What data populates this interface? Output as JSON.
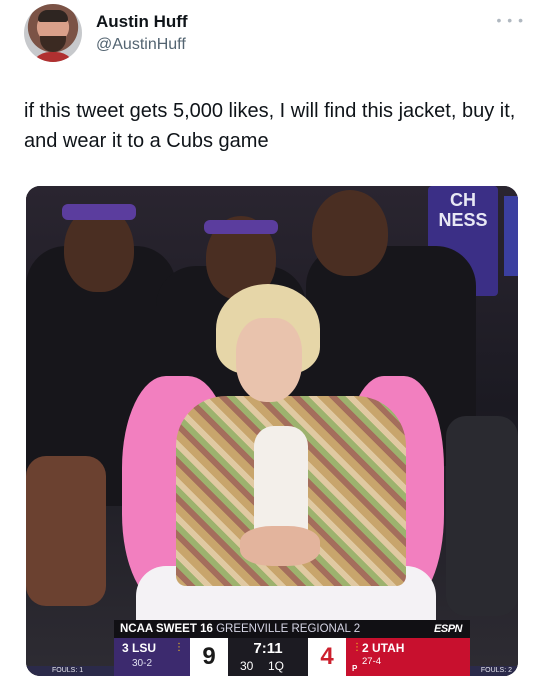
{
  "author": {
    "display_name": "Austin Huff",
    "handle": "@AustinHuff",
    "more_icon": "more-dots-icon"
  },
  "tweet": {
    "text": "if this tweet gets 5,000 likes, I will find this jacket, buy it, and wear it to a Cubs game"
  },
  "media": {
    "banner_text": "CH\nNESS",
    "scorebug": {
      "title": "NCAA SWEET 16",
      "region": "GREENVILLE REGIONAL 2",
      "network": "ESPN",
      "home": {
        "name": "3 LSU",
        "record": "30-2",
        "score": "9",
        "fouls": "FOULS: 1"
      },
      "away": {
        "name": "2 UTAH",
        "record": "27-4",
        "score": "4",
        "fouls": "FOULS: 2",
        "possession": "P"
      },
      "clock": "7:11",
      "shot_clock": "30",
      "period": "1Q",
      "timeout_marks": "⋮"
    },
    "colors": {
      "lsu_purple": "#3c2a6e",
      "utah_red": "#c8102e",
      "jacket_pink": "#f27fbf"
    }
  }
}
